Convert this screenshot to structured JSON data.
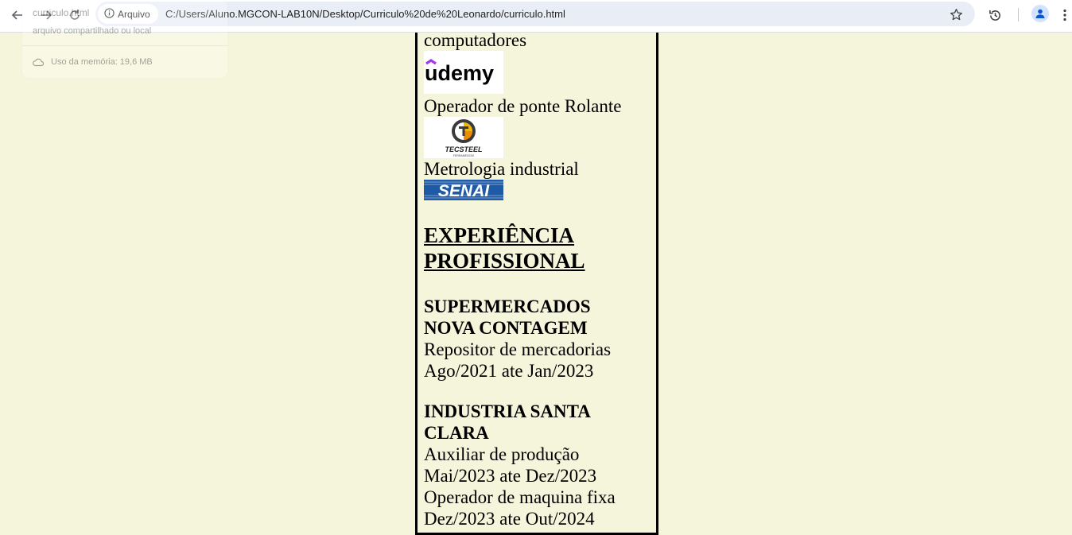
{
  "browser": {
    "chip_label": "Arquivo",
    "url": "C:/Users/Aluno.MGCON-LAB10N/Desktop/Curriculo%20de%20Leonardo/curriculo.html",
    "icons": [
      "back-icon",
      "forward-icon",
      "reload-icon",
      "info-icon",
      "star-icon",
      "history-icon",
      "profile-icon",
      "more-icon"
    ]
  },
  "hover_card": {
    "title": "curriculo.html",
    "subtitle": "arquivo compartilhado ou local",
    "memory": "Uso da memória: 19,6 MB"
  },
  "page": {
    "course_1_tail": "computadores",
    "course_2": "Operador de ponte Rolante",
    "course_3": "Metrologia industrial",
    "logos": {
      "udemy": "udemy",
      "tecsteel": "TECSTEEL",
      "tecsteel_sub": "FERRAMENTAS",
      "senai": "SENAI"
    },
    "experience_heading_line1": "EXPERIÊNCIA",
    "experience_heading_line2": "PROFISSIONAL",
    "jobs": [
      {
        "company_line1": "SUPERMERCADOS",
        "company_line2": "NOVA CONTAGEM",
        "role": "Repositor de mercadorias",
        "period": "Ago/2021 ate Jan/2023"
      },
      {
        "company_line1": "INDUSTRIA SANTA",
        "company_line2": "CLARA",
        "role": "Auxiliar de produção",
        "period": "Mai/2023 ate Dez/2023",
        "role_2": "Operador de maquina fixa",
        "period_2": "Dez/2023 ate Out/2024"
      }
    ],
    "colors": {
      "background": "#f5f5dc",
      "senai_blue": "#1f5aa6",
      "udemy_purple": "#a435f0"
    }
  }
}
